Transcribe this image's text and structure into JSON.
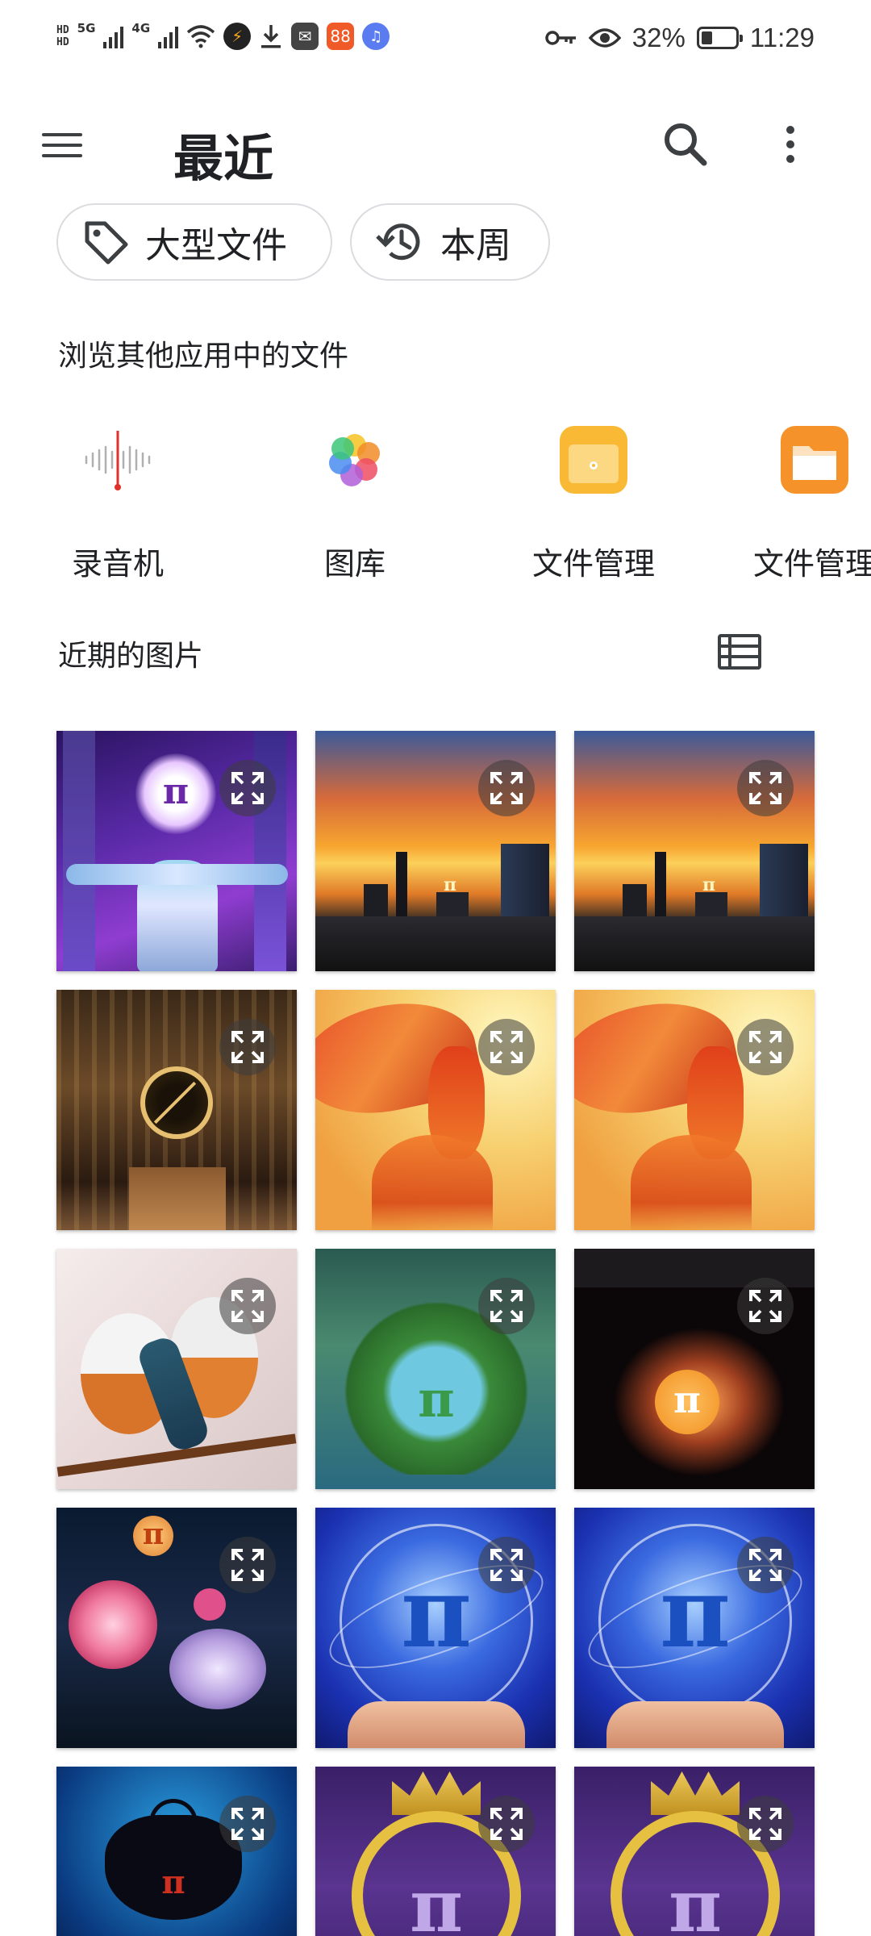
{
  "status_bar": {
    "hd1": "HD",
    "hd2": "HD",
    "net1": "5G",
    "net2": "4G",
    "battery_percent": "32%",
    "time": "11:29",
    "icons": [
      "signal-icon",
      "wifi-icon",
      "charge-saver-icon",
      "download-icon",
      "mail-icon",
      "app-icon",
      "music-icon",
      "key-icon",
      "eye-icon",
      "battery-icon"
    ]
  },
  "app_bar": {
    "title": "最近"
  },
  "chips": [
    {
      "label": "大型文件",
      "icon": "tag-icon"
    },
    {
      "label": "本周",
      "icon": "history-icon"
    }
  ],
  "browse": {
    "title": "浏览其他应用中的文件",
    "apps": [
      {
        "label": "录音机",
        "icon": "voice-recorder-icon"
      },
      {
        "label": "图库",
        "icon": "gallery-icon"
      },
      {
        "label": "文件管理",
        "icon": "file-manager-icon"
      },
      {
        "label": "文件管理",
        "icon": "file-manager-icon"
      }
    ]
  },
  "recent_images": {
    "title": "近期的图片",
    "view_toggle_icon": "list-view-icon",
    "images": [
      {
        "subject": "pi-robot"
      },
      {
        "subject": "sunset-city"
      },
      {
        "subject": "sunset-city"
      },
      {
        "subject": "clock-machine"
      },
      {
        "subject": "phoenix"
      },
      {
        "subject": "phoenix"
      },
      {
        "subject": "birds"
      },
      {
        "subject": "heart-lake"
      },
      {
        "subject": "hands-coin"
      },
      {
        "subject": "peonies"
      },
      {
        "subject": "globe-hands"
      },
      {
        "subject": "globe-hands"
      },
      {
        "subject": "cauldron"
      },
      {
        "subject": "crown"
      },
      {
        "subject": "crown"
      }
    ],
    "pi_symbol": "π"
  },
  "colors": {
    "accent_orange": "#f5a623",
    "text_primary": "#202124",
    "chip_border": "#dadce0"
  }
}
